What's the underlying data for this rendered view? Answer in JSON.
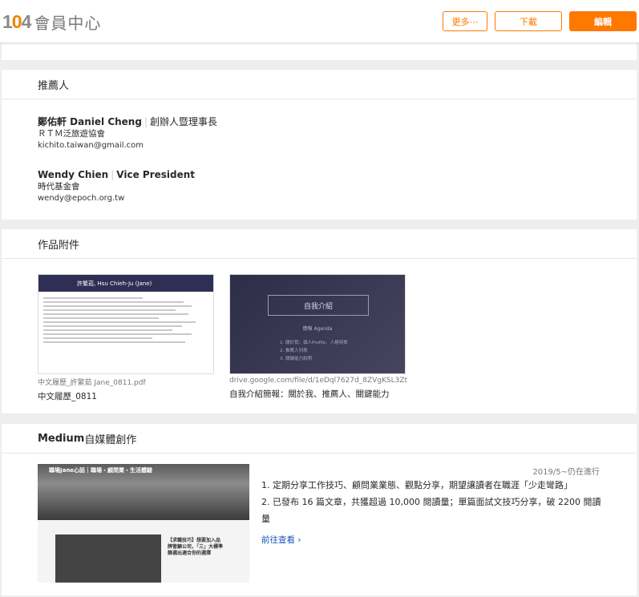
{
  "header": {
    "logo_number": "104",
    "logo_text": "會員中心",
    "more_button": "更多⋯",
    "download_button": "下載",
    "edit_button": "編輯"
  },
  "recommenders": {
    "title": "推薦人",
    "items": [
      {
        "name": "鄭佑軒 Daniel Cheng",
        "role": "創辦人暨理事長",
        "org": "ＲＴＭ泛旅遊協會",
        "email": "kichito.taiwan@gmail.com"
      },
      {
        "name": "Wendy Chien",
        "role": "Vice President",
        "org": "時代基金會",
        "email": "wendy@epoch.org.tw"
      }
    ]
  },
  "attachments": {
    "title": "作品附件",
    "items": [
      {
        "filename": "中文履歷_許繁茹 Jane_0811.pdf",
        "title": "中文履歷_0811",
        "thumb_header": "許繁茹, Hsu Chieh-Ju (Jane)"
      },
      {
        "filename": "drive.google.com/file/d/1eDql7627d_8ZVgKSL3ZtQK...",
        "title": "自我介紹簡報：關於我、推薦人、關鍵能力",
        "thumb_title": "自我介紹",
        "thumb_sub": "簡報 Agenda",
        "thumb_items": [
          "1. 關於我：個人Profile、人格特質",
          "2. 推薦人列表",
          "3. 關鍵能力說明"
        ]
      }
    ]
  },
  "medium": {
    "title_bold": "Medium",
    "title_rest": " 自媒體創作",
    "banner": "職場Jane心話｜職場・顧問業・生活體驗",
    "thumb_caption": "【求職技巧】想要加入品牌管顧公司，「三」大標準篩選出適合你的選擇",
    "date": "2019/5~仍在進行",
    "line1": "1. 定期分享工作技巧、顧問業業態、觀點分享，期望讓讀者在職涯「少走彎路」",
    "line2": "2. 已發布 16 篇文章，共獲超過 10,000 閱讀量；單篇面試文技巧分享，破 2200 閱讀量",
    "link": "前往查看"
  },
  "colors": {
    "accent": "#ff7800",
    "link": "#1654b9",
    "background": "#eeeeee"
  }
}
